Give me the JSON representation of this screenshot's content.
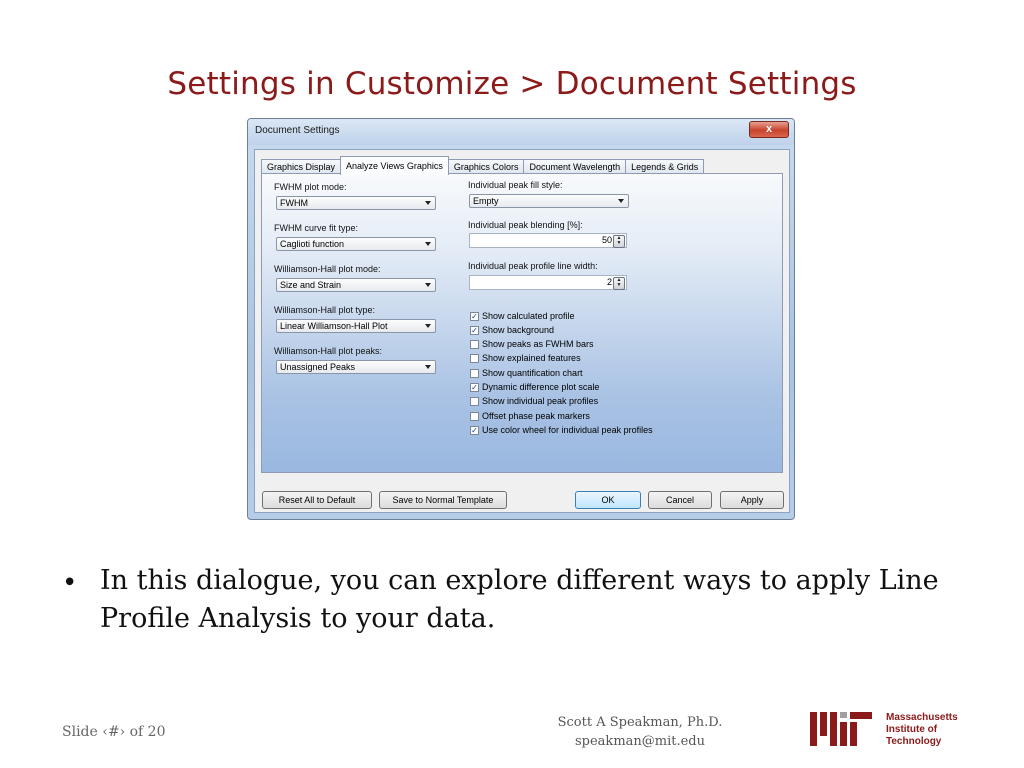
{
  "slide": {
    "title": "Settings in Customize > Document Settings",
    "bullet": "In this dialogue, you can explore different ways to apply Line Profile Analysis to your data.",
    "slide_number": "Slide ‹#› of 20",
    "author_name": "Scott A Speakman, Ph.D.",
    "author_email": "speakman@mit.edu",
    "institution_lines": [
      "Massachusetts",
      "Institute of",
      "Technology"
    ]
  },
  "dialog": {
    "title": "Document Settings",
    "close_symbol": "x",
    "tabs": [
      {
        "label": "Graphics Display",
        "active": false
      },
      {
        "label": "Analyze Views Graphics",
        "active": true
      },
      {
        "label": "Graphics Colors",
        "active": false
      },
      {
        "label": "Document Wavelength",
        "active": false
      },
      {
        "label": "Legends & Grids",
        "active": false
      }
    ],
    "left_fields": [
      {
        "label": "FWHM plot mode:",
        "value": "FWHM"
      },
      {
        "label": "FWHM curve fit type:",
        "value": "Caglioti function"
      },
      {
        "label": "Williamson-Hall plot mode:",
        "value": "Size and Strain"
      },
      {
        "label": "Williamson-Hall plot type:",
        "value": "Linear Williamson-Hall Plot"
      },
      {
        "label": "Williamson-Hall plot peaks:",
        "value": "Unassigned Peaks"
      }
    ],
    "fill_style": {
      "label": "Individual peak fill style:",
      "value": "Empty"
    },
    "blending": {
      "label": "Individual peak blending [%]:",
      "value": "50"
    },
    "line_width": {
      "label": "Individual peak profile line width:",
      "value": "2"
    },
    "checkboxes": [
      {
        "label": "Show calculated profile",
        "checked": true
      },
      {
        "label": "Show background",
        "checked": true
      },
      {
        "label": "Show peaks as FWHM bars",
        "checked": false
      },
      {
        "label": "Show explained features",
        "checked": false
      },
      {
        "label": "Show quantification chart",
        "checked": false
      },
      {
        "label": "Dynamic difference plot scale",
        "checked": true
      },
      {
        "label": "Show individual peak profiles",
        "checked": false
      },
      {
        "label": "Offset phase peak markers",
        "checked": false
      },
      {
        "label": "Use color wheel for individual peak profiles",
        "checked": true
      }
    ],
    "buttons": {
      "reset": "Reset All to Default",
      "save": "Save to Normal Template",
      "ok": "OK",
      "cancel": "Cancel",
      "apply": "Apply"
    }
  },
  "icons": {
    "check": "✓",
    "spin_up": "▲",
    "spin_down": "▼"
  }
}
